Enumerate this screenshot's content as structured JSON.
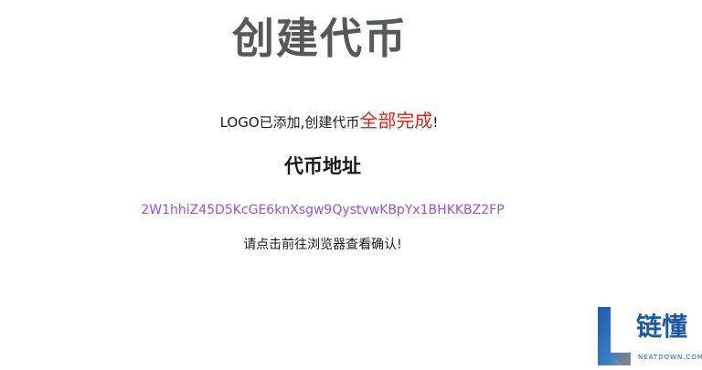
{
  "page": {
    "title": "创建代币",
    "status": {
      "prefix": "LOGO已添加,创建代币",
      "highlight": "全部完成",
      "suffix": "!"
    },
    "address_heading": "代币地址",
    "address": "2W1hhiZ45D5KcGE6knXsgw9QystvwKBpYx1BHKKBZ2FP",
    "instruction": "请点击前往浏览器查看确认!"
  },
  "watermark": {
    "name_cn": "链懂",
    "domain": "NEATDOWN.COM",
    "icon": "letter-l-logo-icon"
  },
  "colors": {
    "title": "#55595c",
    "highlight": "#e0261c",
    "address_link": "#9b51d6",
    "watermark": "#1d5aa6"
  }
}
